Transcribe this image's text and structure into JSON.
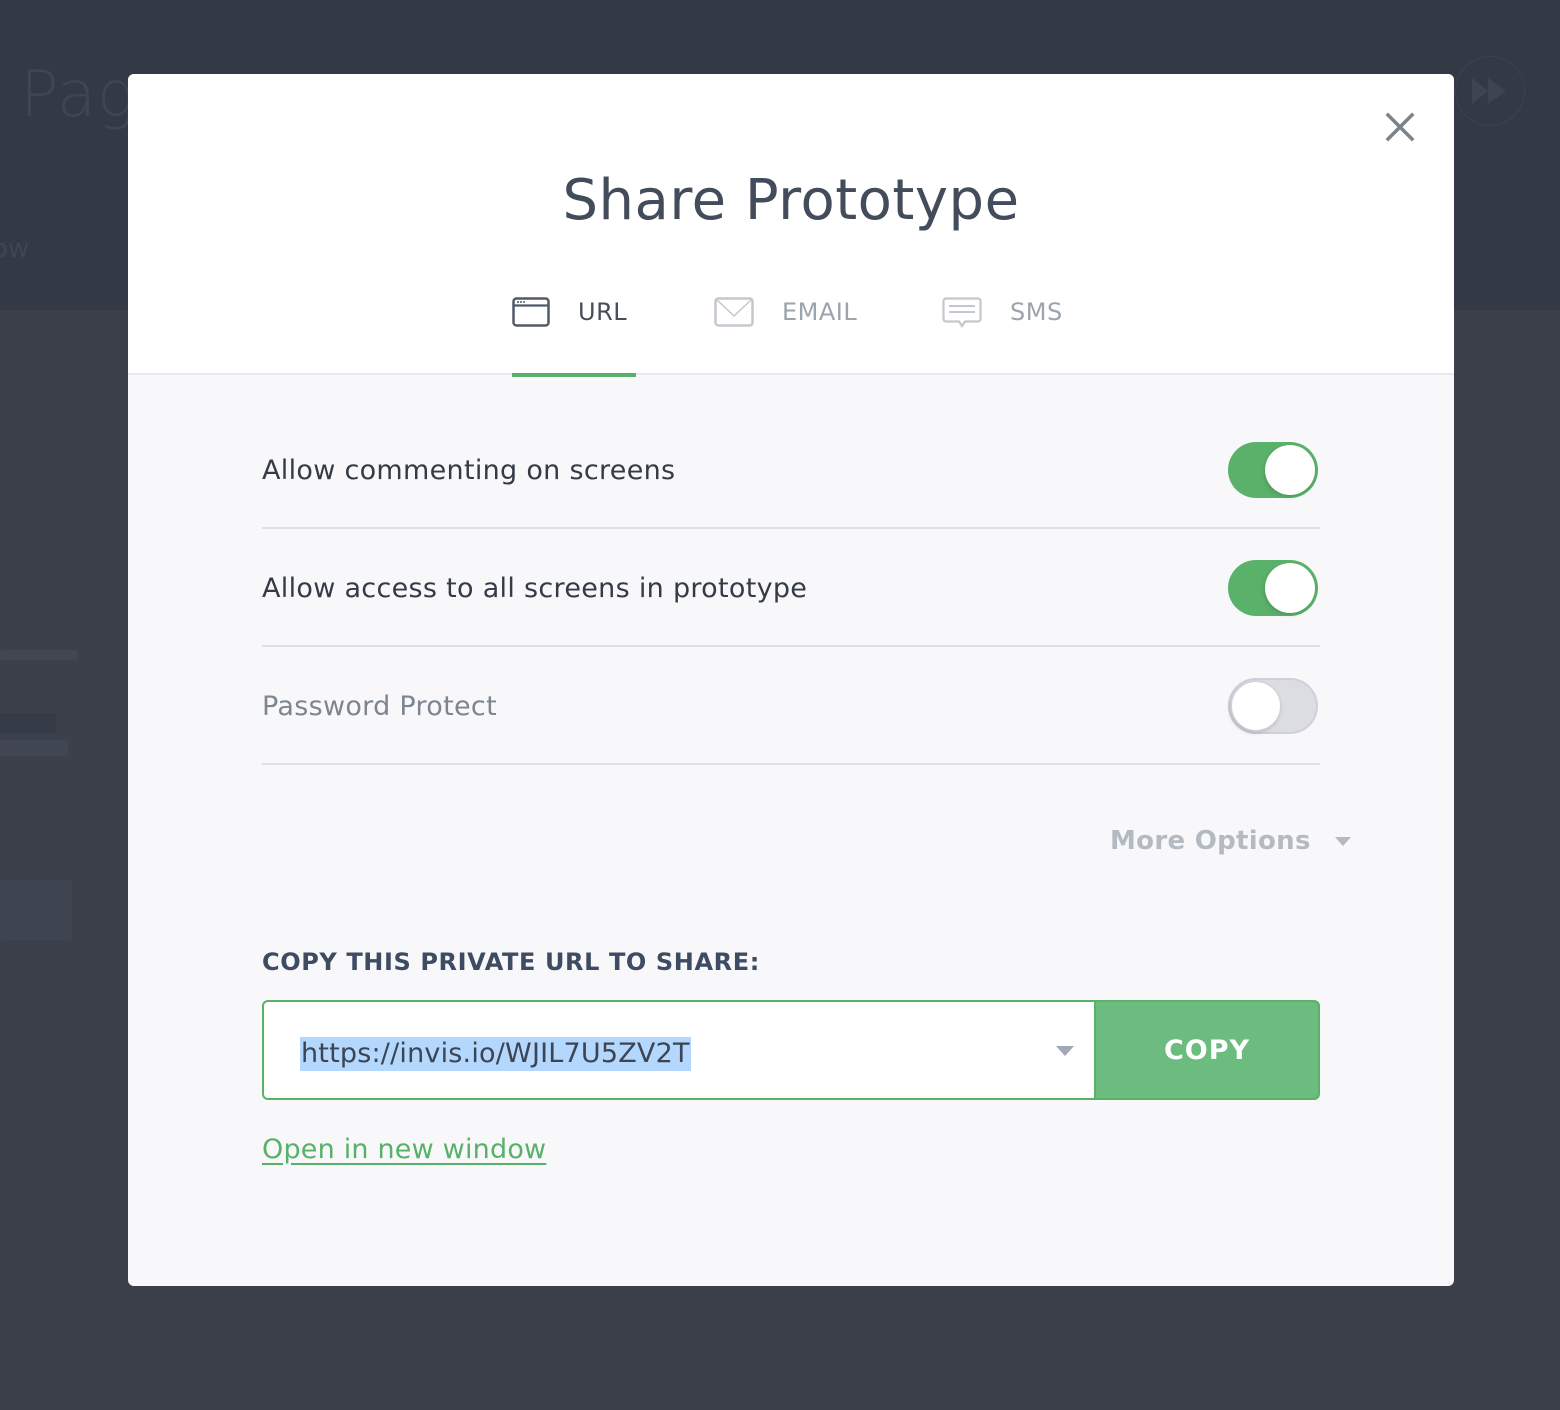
{
  "background": {
    "page_title_fragment": "Pag",
    "subtitle_fragment": "ow",
    "fast_forward_icon": "fast-forward-icon"
  },
  "modal": {
    "title": "Share Prototype",
    "close_icon": "close-icon",
    "tabs": [
      {
        "label": "URL",
        "icon": "browser-window-icon",
        "active": true
      },
      {
        "label": "EMAIL",
        "icon": "envelope-icon",
        "active": false
      },
      {
        "label": "SMS",
        "icon": "chat-bubble-icon",
        "active": false
      }
    ],
    "settings": [
      {
        "label": "Allow commenting on screens",
        "enabled": true
      },
      {
        "label": "Allow access to all screens in prototype",
        "enabled": true
      },
      {
        "label": "Password Protect",
        "enabled": false
      }
    ],
    "more_options": {
      "label": "More Options",
      "icon": "caret-down-icon"
    },
    "url_section": {
      "heading": "COPY THIS PRIVATE URL TO SHARE:",
      "url_value": "https://invis.io/WJIL7U5ZV2T",
      "dropdown_icon": "caret-down-icon",
      "copy_label": "COPY"
    },
    "open_link": "Open in new window"
  },
  "colors": {
    "accent_green": "#5ab16a",
    "copy_button": "#6dbc7f",
    "overlay": "#3b404b",
    "title_text": "#434c5b",
    "selection_highlight": "#b3d7fd"
  }
}
